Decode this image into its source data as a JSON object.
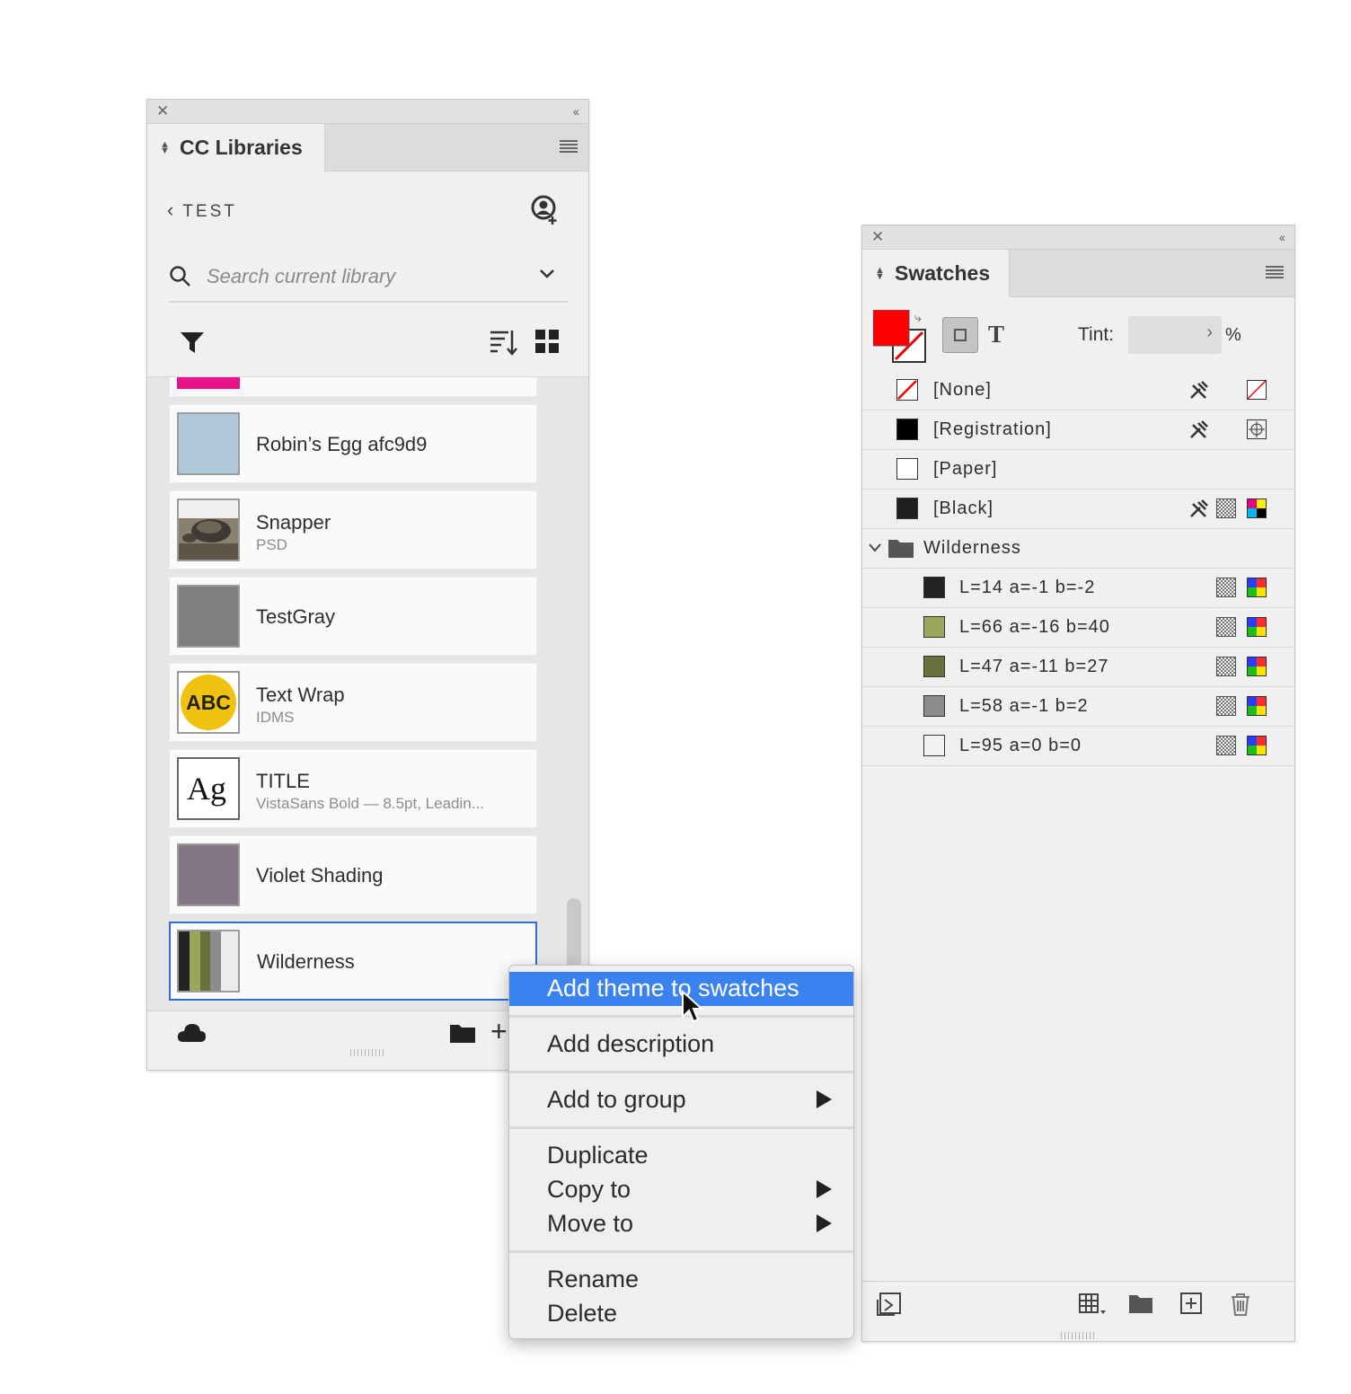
{
  "cc_panel": {
    "tab_title": "CC Libraries",
    "library_name": "TEST",
    "search": {
      "placeholder": "Search current library",
      "value": ""
    },
    "items": [
      {
        "name": "",
        "subtitle": "",
        "thumb": "color",
        "color": "#e8138b"
      },
      {
        "name": "Robin’s Egg afc9d9",
        "subtitle": "",
        "thumb": "color",
        "color": "#afc9d9"
      },
      {
        "name": "Snapper",
        "subtitle": "PSD",
        "thumb": "photo",
        "color": "#6b6455"
      },
      {
        "name": "TestGray",
        "subtitle": "",
        "thumb": "color",
        "color": "#808080"
      },
      {
        "name": "Text Wrap",
        "subtitle": "IDMS",
        "thumb": "abc",
        "thumb_text": "ABC",
        "color": "#f2c210"
      },
      {
        "name": "TITLE",
        "subtitle": "VistaSans Bold — 8.5pt, Leadin...",
        "thumb": "text",
        "thumb_text": "Ag"
      },
      {
        "name": "Violet Shading",
        "subtitle": "",
        "thumb": "color",
        "color": "#857686"
      },
      {
        "name": "Wilderness",
        "subtitle": "",
        "thumb": "theme",
        "colors": [
          "#232323",
          "#9aa65a",
          "#6a7039",
          "#8c8c8c",
          "#ececec"
        ],
        "selected": true
      }
    ]
  },
  "context_menu": {
    "groups": [
      [
        {
          "label": "Add theme to swatches",
          "highlighted": true,
          "submenu": false
        }
      ],
      [
        {
          "label": "Add description",
          "submenu": false
        }
      ],
      [
        {
          "label": "Add to group",
          "submenu": true
        }
      ],
      [
        {
          "label": "Duplicate",
          "submenu": false
        },
        {
          "label": "Copy to",
          "submenu": true
        },
        {
          "label": "Move to",
          "submenu": true
        }
      ],
      [
        {
          "label": "Rename",
          "submenu": false
        },
        {
          "label": "Delete",
          "submenu": false
        }
      ]
    ]
  },
  "swatches_panel": {
    "tab_title": "Swatches",
    "tint_label": "Tint:",
    "tint_value": "",
    "tint_unit": "%",
    "fill_color": "#ff0000",
    "rows": [
      {
        "name": "[None]",
        "type": "none",
        "indent": 0,
        "locked": true,
        "mode_icon": "none-icon"
      },
      {
        "name": "[Registration]",
        "type": "swatch",
        "color": "#000000",
        "indent": 0,
        "locked": true,
        "mode_icon": "registration-icon"
      },
      {
        "name": "[Paper]",
        "type": "swatch",
        "color": "#ffffff",
        "indent": 0,
        "locked": false,
        "mode_icon": ""
      },
      {
        "name": "[Black]",
        "type": "swatch",
        "color": "#1f1f1f",
        "indent": 0,
        "locked": true,
        "process": true,
        "mode_icon": "cmyk"
      },
      {
        "name": "Wilderness",
        "type": "group",
        "indent": 0
      },
      {
        "name": "L=14 a=-1 b=-2",
        "type": "swatch",
        "color": "#232323",
        "indent": 1,
        "process": true,
        "mode_icon": "lab"
      },
      {
        "name": "L=66 a=-16 b=40",
        "type": "swatch",
        "color": "#9aa65a",
        "indent": 1,
        "process": true,
        "mode_icon": "lab"
      },
      {
        "name": "L=47 a=-11 b=27",
        "type": "swatch",
        "color": "#6a7039",
        "indent": 1,
        "process": true,
        "mode_icon": "lab"
      },
      {
        "name": "L=58 a=-1 b=2",
        "type": "swatch",
        "color": "#8c8c8c",
        "indent": 1,
        "process": true,
        "mode_icon": "lab"
      },
      {
        "name": "L=95 a=0 b=0",
        "type": "swatch",
        "color": "#f2f2f2",
        "indent": 1,
        "process": true,
        "mode_icon": "lab"
      }
    ]
  }
}
